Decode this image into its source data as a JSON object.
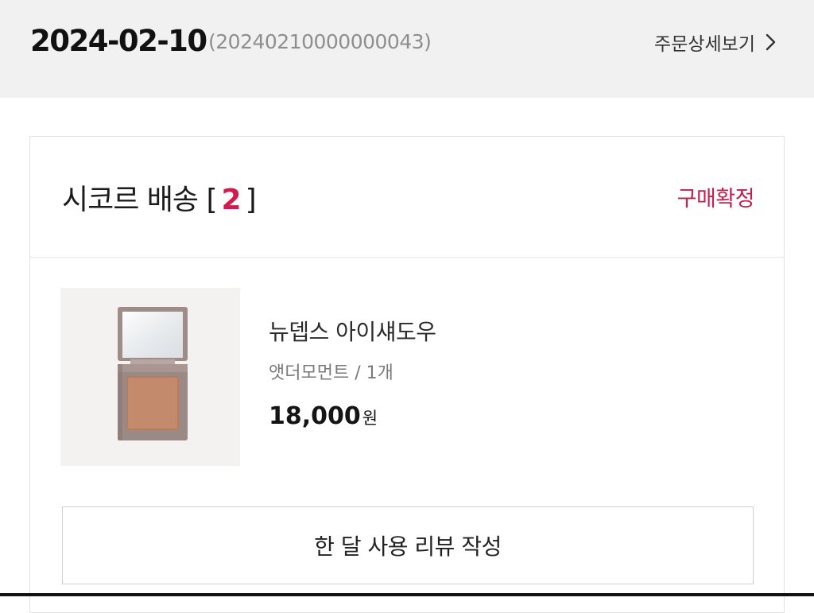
{
  "order": {
    "date": "2024-02-10",
    "number": "(20240210000000043)",
    "detail_link_label": "주문상세보기"
  },
  "shipment": {
    "title": "시코르 배송",
    "bracket_open": "[",
    "count": "2",
    "bracket_close": "]",
    "status": "구매확정"
  },
  "product": {
    "name": "뉴뎁스 아이섀도우",
    "option": "앳더모먼트 / 1개",
    "price": "18,000",
    "currency": "원",
    "image_icon": "eyeshadow-compact"
  },
  "actions": {
    "review_label": "한 달 사용 리뷰 작성"
  },
  "colors": {
    "accent": "#c2204d",
    "header_bg": "#f1f1f1"
  }
}
